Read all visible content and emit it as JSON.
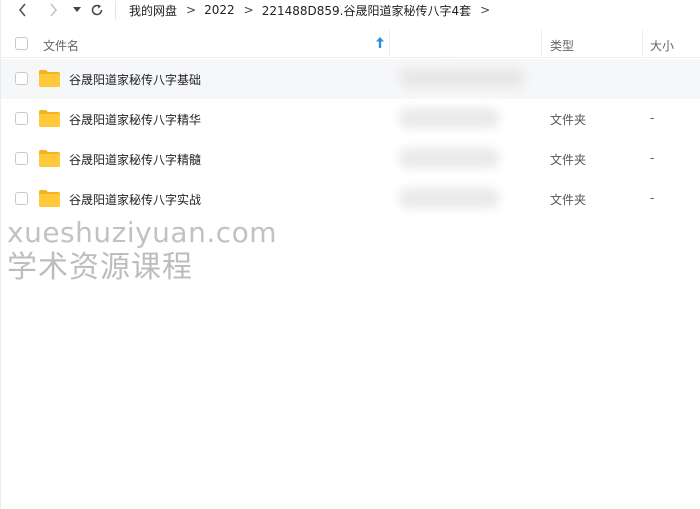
{
  "colors": {
    "folder": "#ffc93a",
    "folder_back": "#f4b421",
    "sort_arrow": "#2f8fd8",
    "selected_row": "#f6f7f9"
  },
  "nav": {
    "back_icon": "chevron-left-icon",
    "forward_icon": "chevron-right-icon",
    "dropdown_icon": "caret-down-icon",
    "refresh_icon": "refresh-icon"
  },
  "breadcrumb": {
    "items": [
      "我的网盘",
      "2022",
      "221488D859.谷晟阳道家秘传八字4套"
    ],
    "separator": ">"
  },
  "columns": {
    "name": "文件名",
    "type": "类型",
    "size": "大小"
  },
  "files": [
    {
      "name": "谷晟阳道家秘传八字基础",
      "type": "",
      "size": ""
    },
    {
      "name": "谷晟阳道家秘传八字精华",
      "type": "文件夹",
      "size": "-"
    },
    {
      "name": "谷晟阳道家秘传八字精髓",
      "type": "文件夹",
      "size": "-"
    },
    {
      "name": "谷晟阳道家秘传八字实战",
      "type": "文件夹",
      "size": "-"
    }
  ],
  "watermark": {
    "url": "xueshuziyuan.com",
    "text": "学术资源课程"
  }
}
